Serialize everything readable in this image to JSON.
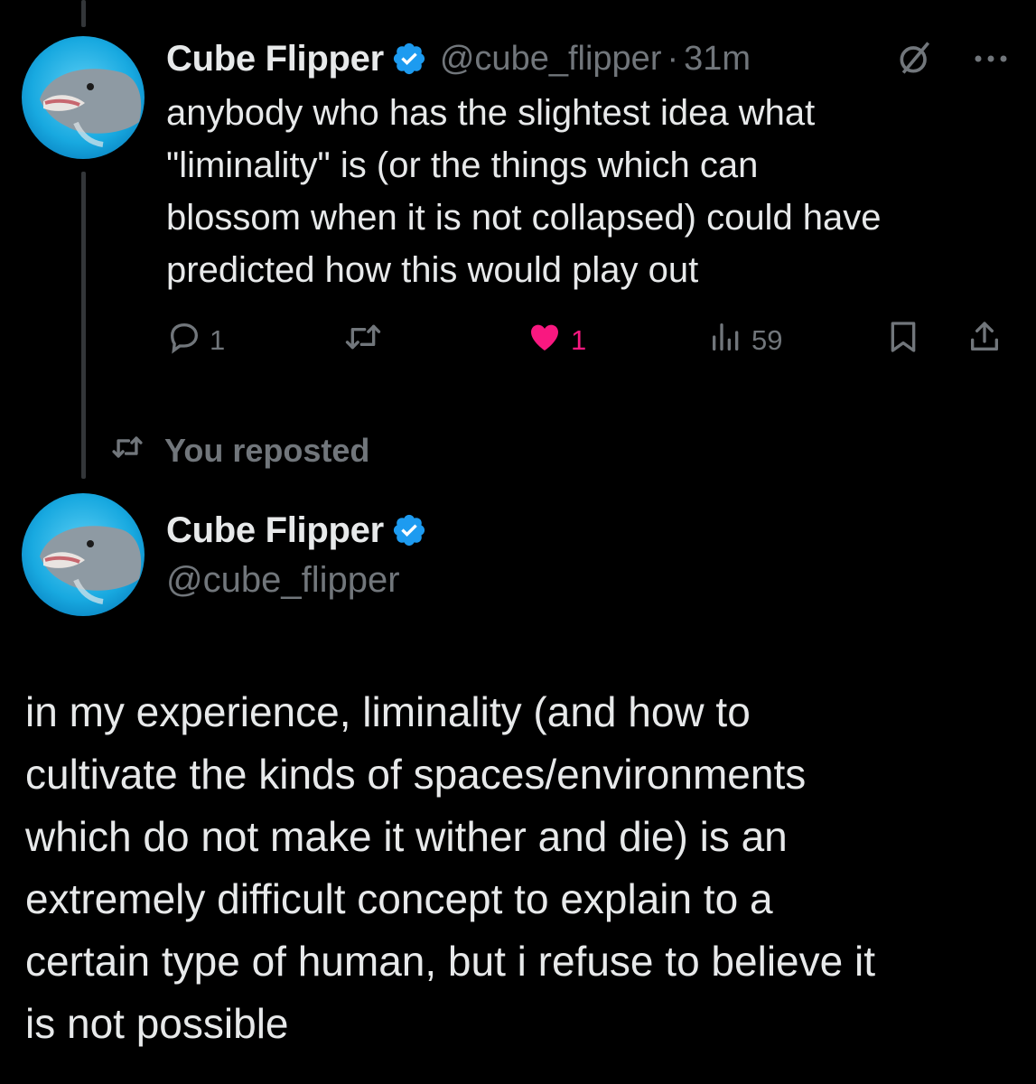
{
  "parent_tweet": {
    "author": {
      "display_name": "Cube Flipper",
      "handle": "@cube_flipper",
      "verified": true
    },
    "separator": "·",
    "time": "31m",
    "text": "anybody who has the slightest idea what\n\"liminality\" is (or the things which can\nblossom when it is not collapsed) could have\npredicted how this would play out",
    "icons": [
      "grok-icon",
      "more-icon"
    ],
    "actions": {
      "reply_count": "1",
      "repost_count": "",
      "like_count": "1",
      "liked": true,
      "views": "59"
    }
  },
  "repost_label": "You reposted",
  "main_tweet": {
    "author": {
      "display_name": "Cube Flipper",
      "handle": "@cube_flipper",
      "verified": true
    },
    "text": "in my experience, liminality (and how to\ncultivate the kinds of spaces/environments\nwhich do not make it wither and die) is an\nextremely difficult concept to explain to a\ncertain type of human, but i refuse to believe it\nis not possible"
  },
  "colors": {
    "background": "#000000",
    "text_primary": "#e7e9ea",
    "text_secondary": "#71767b",
    "verified_blue": "#1d9bf0",
    "like_pink": "#f91880",
    "thread_line": "#333639"
  }
}
